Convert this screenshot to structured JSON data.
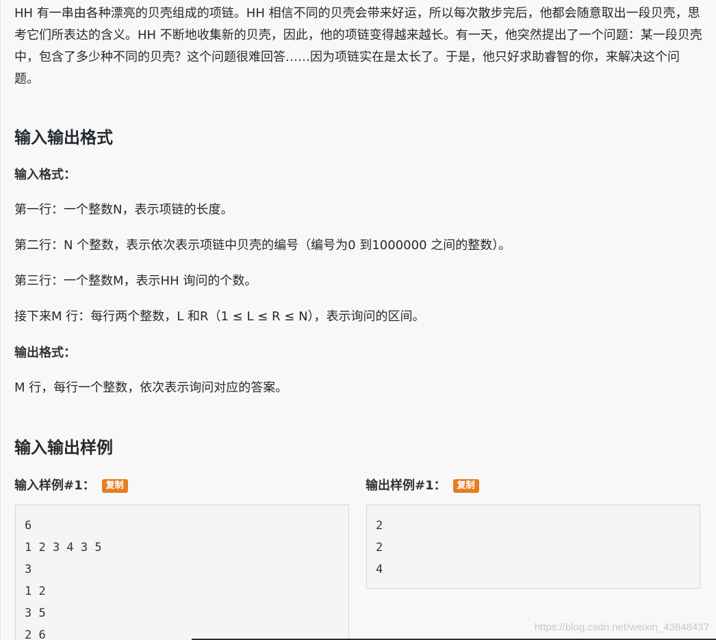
{
  "description": {
    "paragraph": "HH 有一串由各种漂亮的贝壳组成的项链。HH 相信不同的贝壳会带来好运，所以每次散步完后，他都会随意取出一段贝壳，思考它们所表达的含义。HH 不断地收集新的贝壳，因此，他的项链变得越来越长。有一天，他突然提出了一个问题：某一段贝壳中，包含了多少种不同的贝壳？这个问题很难回答……因为项链实在是太长了。于是，他只好求助睿智的你，来解决这个问题。"
  },
  "io_format": {
    "heading": "输入输出格式",
    "input_label": "输入格式：",
    "input_lines": [
      "第一行：一个整数N，表示项链的长度。",
      "第二行：N 个整数，表示依次表示项链中贝壳的编号（编号为0 到1000000 之间的整数）。",
      "第三行：一个整数M，表示HH 询问的个数。",
      "接下来M 行：每行两个整数，L 和R（1 ≤ L ≤ R ≤ N），表示询问的区间。"
    ],
    "output_label": "输出格式：",
    "output_lines": [
      "M 行，每行一个整数，依次表示询问对应的答案。"
    ]
  },
  "samples": {
    "heading": "输入输出样例",
    "input_title": "输入样例#1：",
    "output_title": "输出样例#1：",
    "copy_label": "复制",
    "input_text": "6\n1 2 3 4 3 5\n3\n1 2\n3 5\n2 6",
    "output_text": "2\n2\n4"
  },
  "watermark": "https://blog.csdn.net/weixin_43848437",
  "colors": {
    "copy_button": "#e67e22",
    "background": "#f8f8f8"
  }
}
